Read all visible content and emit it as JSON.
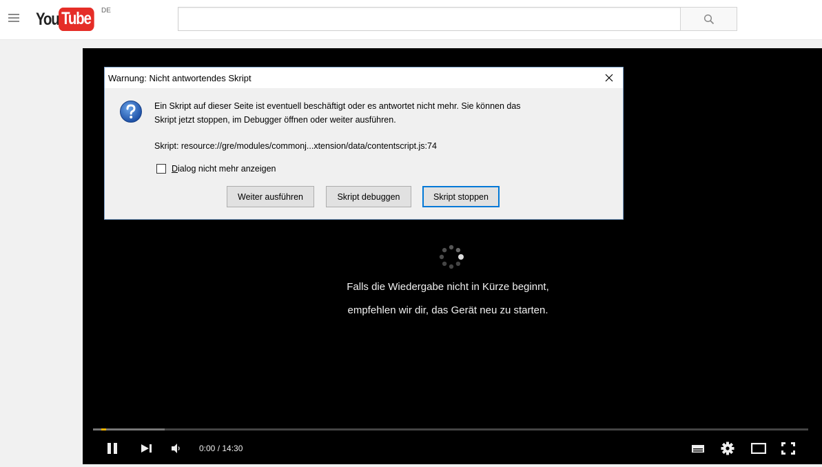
{
  "masthead": {
    "logo_you": "You",
    "logo_tube": "Tube",
    "region": "DE",
    "search_value": "",
    "search_placeholder": ""
  },
  "player": {
    "message_line1": "Falls die Wiedergabe nicht in Kürze beginnt,",
    "message_line2": "empfehlen wir dir, das Gerät neu zu starten.",
    "time_display": "0:00 / 14:30",
    "progress_loaded": 0.1,
    "colors": {
      "played": "#f4b400",
      "background": "#000000"
    }
  },
  "dialog": {
    "title": "Warnung: Nicht antwortendes Skript",
    "message_line1": "Ein Skript auf dieser Seite ist eventuell beschäftigt oder es antwortet nicht mehr. Sie können das",
    "message_line2": "Skript jetzt stoppen, im Debugger öffnen oder weiter ausführen.",
    "script_path": "Skript: resource://gre/modules/commonj...xtension/data/contentscript.js:74",
    "checkbox_label_first": "D",
    "checkbox_label_rest": "ialog nicht mehr anzeigen",
    "checkbox_checked": false,
    "buttons": {
      "continue": "Weiter ausführen",
      "debug": "Skript debuggen",
      "stop": "Skript stoppen"
    }
  }
}
